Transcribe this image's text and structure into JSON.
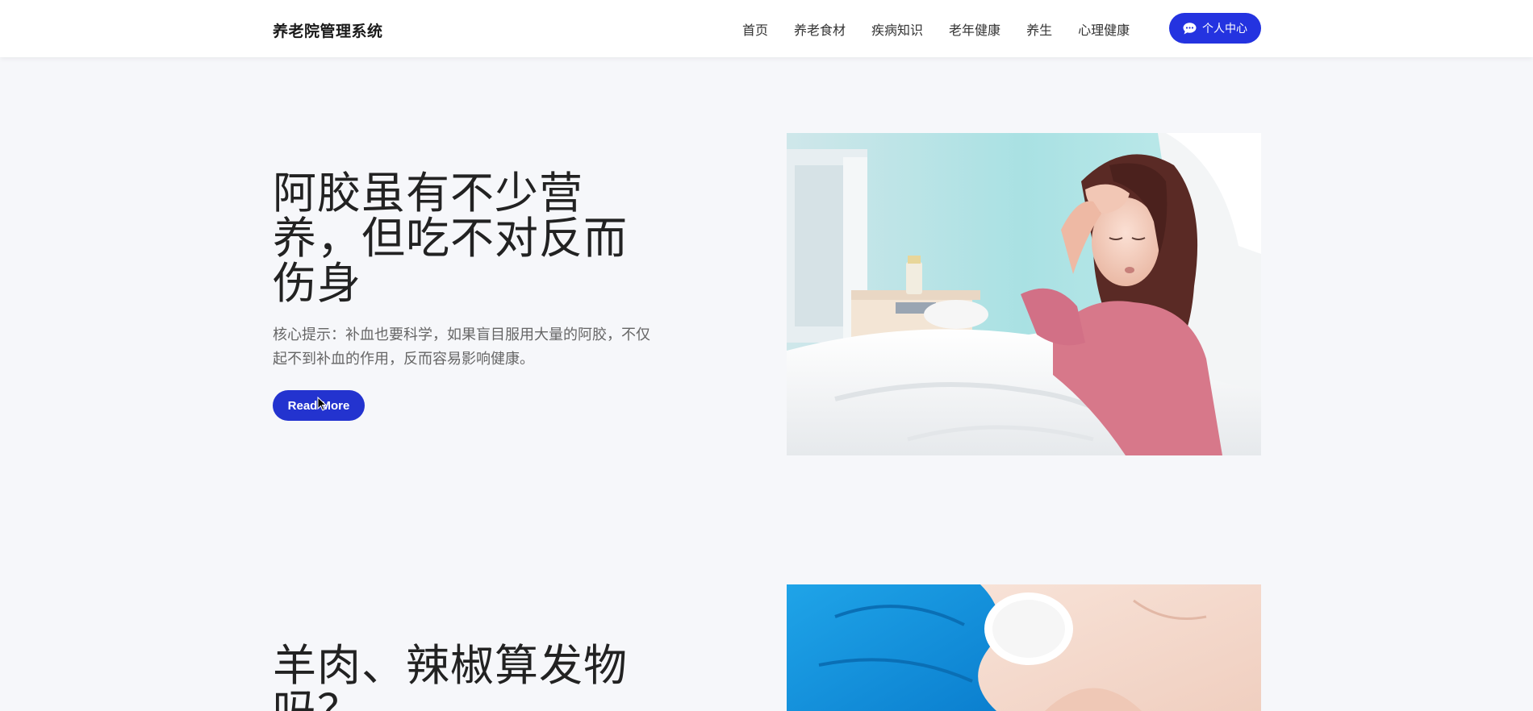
{
  "header": {
    "brand": "养老院管理系统",
    "nav": [
      "首页",
      "养老食材",
      "疾病知识",
      "老年健康",
      "养生",
      "心理健康"
    ],
    "user_center": "个人中心"
  },
  "articles": [
    {
      "title": "阿胶虽有不少营养，但吃不对反而伤身",
      "description": "核心提示：补血也要科学，如果盲目服用大量的阿胶，不仅起不到补血的作用，反而容易影响健康。",
      "button": "Read More"
    },
    {
      "title": "羊肉、辣椒算发物吗？"
    }
  ],
  "colors": {
    "accent": "#2433e0",
    "background": "#f6f7fa"
  }
}
